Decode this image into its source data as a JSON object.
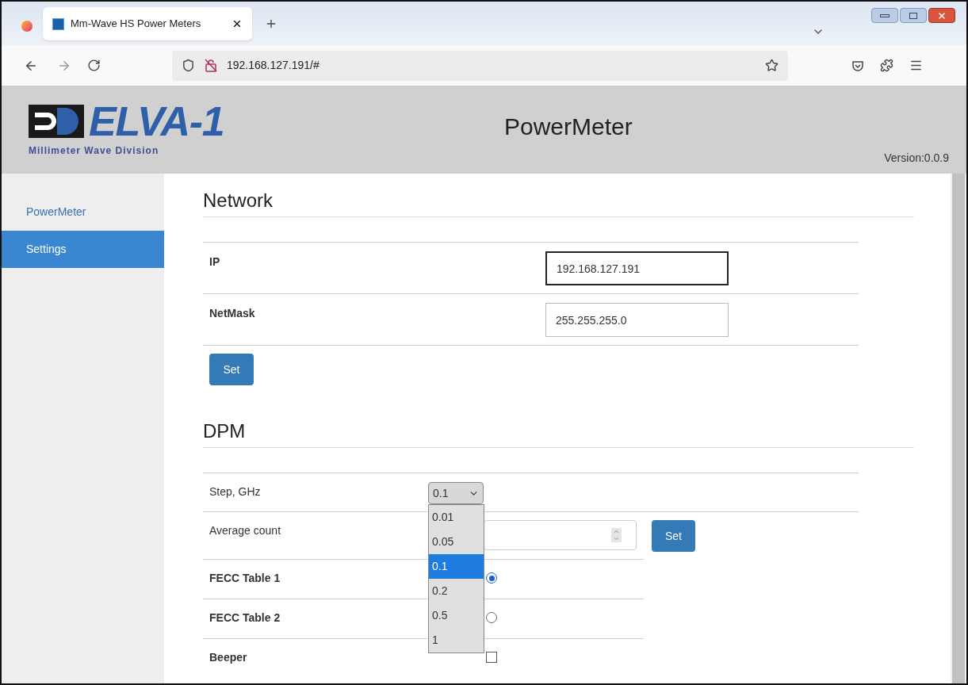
{
  "browser": {
    "tab_title": "Mm-Wave HS Power Meters",
    "url": "192.168.127.191/#"
  },
  "header": {
    "logo_text": "ELVA-1",
    "logo_subtitle": "Millimeter Wave Division",
    "title": "PowerMeter",
    "version": "Version:0.0.9"
  },
  "sidebar": {
    "items": [
      {
        "label": "PowerMeter",
        "selected": false
      },
      {
        "label": "Settings",
        "selected": true
      }
    ]
  },
  "network": {
    "title": "Network",
    "fields": [
      {
        "label": "IP",
        "value": "192.168.127.191",
        "focused": true
      },
      {
        "label": "NetMask",
        "value": "255.255.255.0",
        "focused": false
      }
    ],
    "button": "Set"
  },
  "dpm": {
    "title": "DPM",
    "rows": [
      {
        "kind": "select",
        "label": "Step, GHz",
        "bold": false,
        "value": "0.1",
        "expanded": true,
        "options": [
          {
            "label": "0.01",
            "selected": false
          },
          {
            "label": "0.05",
            "selected": false
          },
          {
            "label": "0.1",
            "selected": true
          },
          {
            "label": "0.2",
            "selected": false
          },
          {
            "label": "0.5",
            "selected": false
          },
          {
            "label": "1",
            "selected": false
          }
        ]
      },
      {
        "kind": "number",
        "label": "Average count",
        "bold": false,
        "button": "Set"
      },
      {
        "kind": "radio",
        "label": "FECC Table 1",
        "bold": true,
        "checked": true
      },
      {
        "kind": "radio",
        "label": "FECC Table 2",
        "bold": true,
        "checked": false
      },
      {
        "kind": "checkbox",
        "label": "Beeper",
        "bold": true,
        "checked": false
      }
    ]
  }
}
